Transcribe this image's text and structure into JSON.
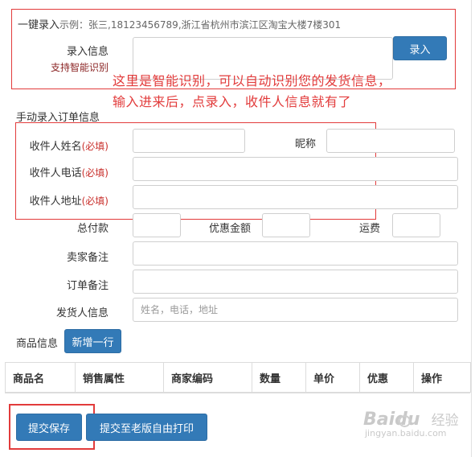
{
  "quick_entry": {
    "title": "一键录入",
    "example": "示例：张三,18123456789,浙江省杭州市滨江区淘宝大楼7楼301",
    "info_label": "录入信息",
    "smart_label": "支持智能识别",
    "info_value": "",
    "submit_label": "录入"
  },
  "annotation": {
    "line1": "这里是智能识别，可以自动识别您的发货信息，",
    "line2": "输入进来后，点录入，收件人信息就有了"
  },
  "manual": {
    "section_title": "手动录入订单信息",
    "required_mark": "(必填)",
    "name_label": "收件人姓名",
    "nickname_label": "昵称",
    "phone_label": "收件人电话",
    "address_label": "收件人地址",
    "total_label": "总付款",
    "discount_label": "优惠金额",
    "shipping_label": "运费",
    "seller_note_label": "卖家备注",
    "order_note_label": "订单备注",
    "sender_label": "发货人信息",
    "sender_placeholder": "姓名，电话，地址"
  },
  "goods": {
    "label": "商品信息",
    "add_row_label": "新增一行",
    "columns": [
      "商品名",
      "销售属性",
      "商家编码",
      "数量",
      "单价",
      "优惠",
      "操作"
    ]
  },
  "actions": {
    "save_label": "提交保存",
    "old_print_label": "提交至老版自由打印"
  },
  "watermark": {
    "brand": "Baidu",
    "suffix": "经验",
    "url": "jingyan.baidu.com"
  },
  "colors": {
    "primary": "#337ab7",
    "annotation": "#e23b3b",
    "required": "#c9302c"
  }
}
